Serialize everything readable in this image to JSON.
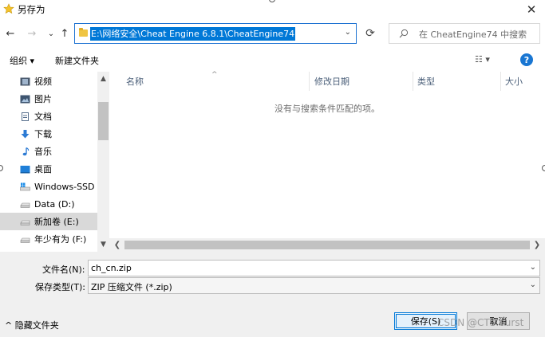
{
  "window": {
    "title": "另存为",
    "close_glyph": "✕"
  },
  "nav": {
    "back_glyph": "←",
    "forward_glyph": "→",
    "recent_glyph": "⌄",
    "up_glyph": "↑",
    "address_path": "E:\\网络安全\\Cheat Engine 6.8.1\\CheatEngine74",
    "address_dropdown_glyph": "⌄",
    "refresh_glyph": "⟳",
    "search_placeholder": "在 CheatEngine74 中搜索"
  },
  "toolbar": {
    "organize_label": "组织 ▾",
    "new_folder_label": "新建文件夹",
    "view_glyph": "☷ ▾",
    "help_glyph": "?"
  },
  "sidebar": {
    "items": [
      {
        "label": "视频",
        "icon": "video-icon"
      },
      {
        "label": "图片",
        "icon": "pictures-icon"
      },
      {
        "label": "文档",
        "icon": "documents-icon"
      },
      {
        "label": "下载",
        "icon": "download-icon"
      },
      {
        "label": "音乐",
        "icon": "music-icon"
      },
      {
        "label": "桌面",
        "icon": "desktop-icon"
      },
      {
        "label": "Windows-SSD (",
        "icon": "windows-drive-icon"
      },
      {
        "label": "Data (D:)",
        "icon": "drive-icon"
      },
      {
        "label": "新加卷 (E:)",
        "icon": "drive-icon",
        "selected": true
      },
      {
        "label": "年少有为 (F:)",
        "icon": "drive-icon"
      }
    ]
  },
  "filelist": {
    "columns": [
      "名称",
      "修改日期",
      "类型",
      "大小"
    ],
    "sort_glyph": "^",
    "empty_message": "没有与搜索条件匹配的项。"
  },
  "form": {
    "filename_label": "文件名(N):",
    "filename_value": "ch_cn.zip",
    "filetype_label": "保存类型(T):",
    "filetype_value": "ZIP 压缩文件 (*.zip)",
    "hide_folders_label": "^ 隐藏文件夹",
    "save_label": "保存(S)",
    "cancel_label": "取消"
  },
  "watermark": "CSDN @CTS.burst",
  "colors": {
    "selection": "#0078d7",
    "help": "#1976d2",
    "address_border": "#1e73d2"
  }
}
